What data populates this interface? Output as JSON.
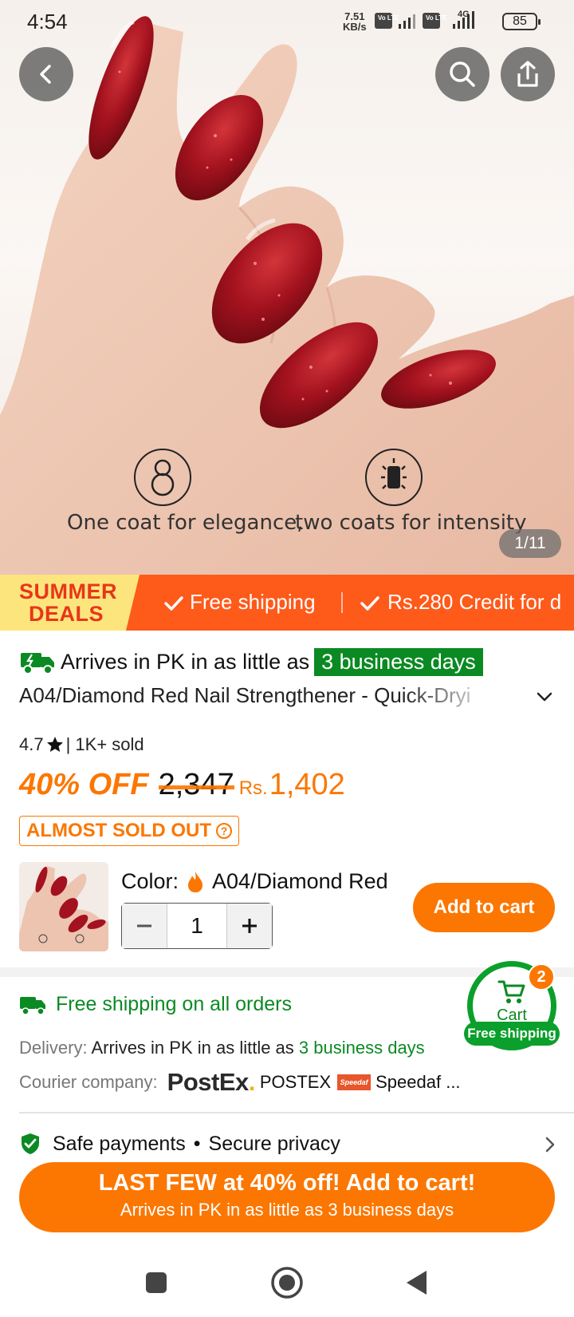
{
  "status_bar": {
    "time": "4:54",
    "net_speed_value": "7.51",
    "net_speed_unit": "KB/s",
    "volte1": "Vo LTE",
    "volte2": "Vo LTE",
    "network_type": "4G",
    "battery": "85"
  },
  "gallery": {
    "caption_left": "One coat for elegance,",
    "caption_right": "two coats for intensity",
    "counter": "1/11"
  },
  "promo": {
    "badge_line1": "SUMMER",
    "badge_line2": "DEALS",
    "item1": "Free shipping",
    "item2": "Rs.280 Credit for d"
  },
  "product": {
    "arrival_text": "Arrives in PK in as little as",
    "arrival_days": "3 business days",
    "title": "A04/Diamond Red Nail Strengthener - Quick-Dryi",
    "rating": "4.7",
    "sold": "| 1K+ sold",
    "discount": "40% OFF",
    "original_price": "2,347",
    "currency": "Rs.",
    "price": "1,402",
    "stock_badge": "ALMOST SOLD OUT",
    "color_label": "Color:",
    "color_value": "A04/Diamond Red",
    "quantity": "1",
    "add_to_cart": "Add to cart"
  },
  "shipping": {
    "free_shipping": "Free shipping on all orders",
    "delivery_label": "Delivery:",
    "delivery_text": "Arrives in PK in as little as",
    "delivery_days": "3 business days",
    "courier_label": "Courier company:",
    "courier1_logo": "PostEx",
    "courier1_name": "POSTEX",
    "courier2_logo": "Speedaf",
    "courier2_name": "Speedaf ...",
    "safe_payments": "Safe payments",
    "secure_privacy": "Secure privacy"
  },
  "floating_cart": {
    "label": "Cart",
    "badge": "2",
    "pill": "Free shipping"
  },
  "cta": {
    "line1": "LAST FEW at 40% off! Add to cart!",
    "line2": "Arrives in PK in as little as 3 business days"
  },
  "colors": {
    "accent_orange": "#fb7701",
    "promo_orange": "#fe5a1a",
    "success_green": "#0b8a23",
    "nail_red": "#a3121e"
  }
}
